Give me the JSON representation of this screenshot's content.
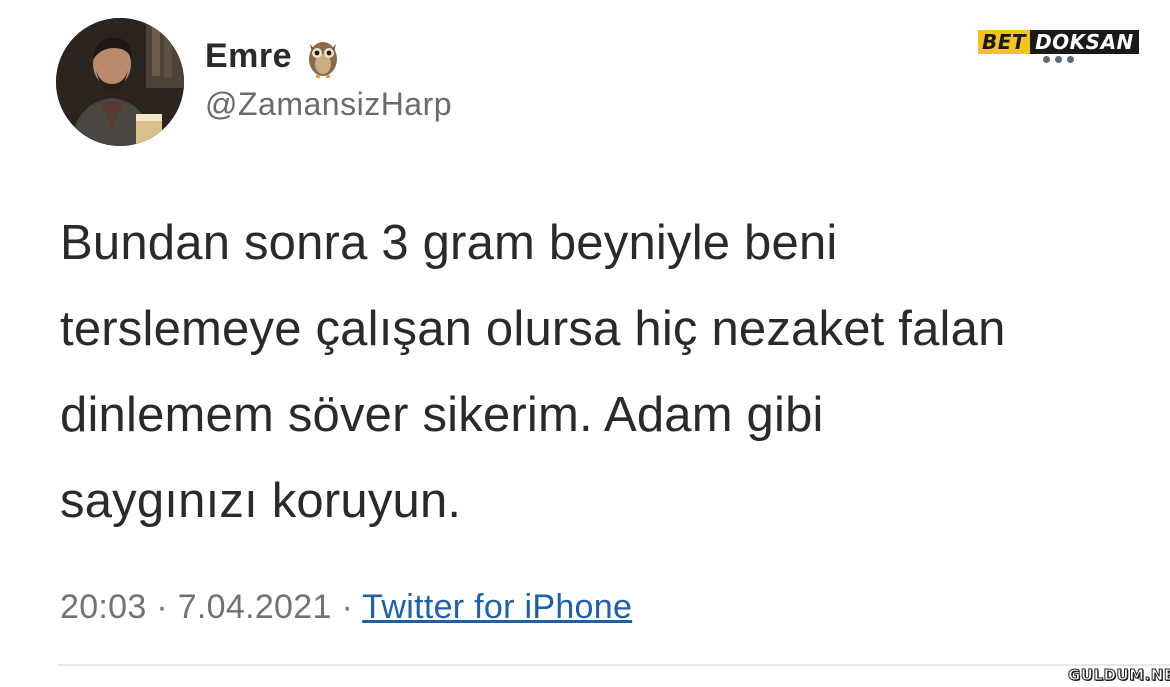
{
  "tweet": {
    "author_name": "Emre",
    "author_handle": "@ZamansizHarp",
    "author_emoji": "owl-emoji",
    "text_lines": [
      "Bundan sonra 3 gram beyniyle beni",
      "terslemeye çalışan olursa hiç nezaket falan",
      "dinlemem söver sikerim. Adam gibi",
      "saygınızı koruyun."
    ],
    "time": "20:03",
    "date": "7.04.2021",
    "separator": "·",
    "source": "Twitter for iPhone"
  },
  "branding": {
    "logo_left": "BET",
    "logo_right": "DOKSAN",
    "watermark": "GULDUM.NET",
    "colors": {
      "logo_yellow": "#f4c41b",
      "logo_black": "#1a1a1a",
      "link_blue": "#1d5fa8",
      "meta_gray": "#6e7378"
    }
  }
}
